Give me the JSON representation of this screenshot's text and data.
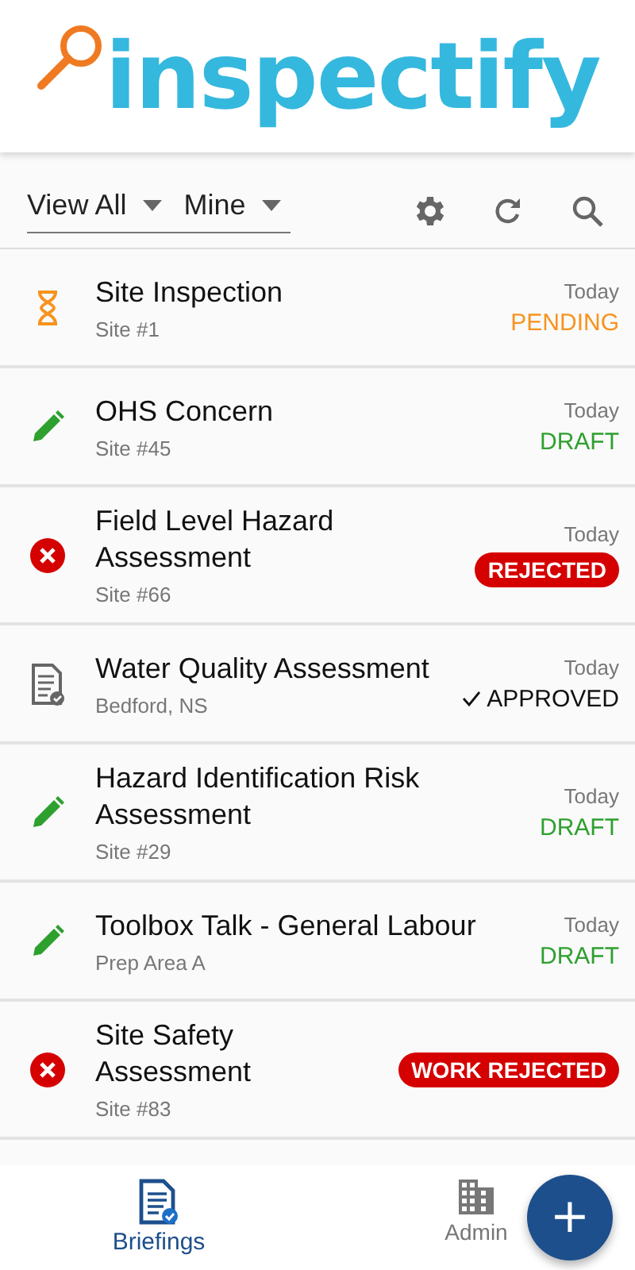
{
  "header": {
    "logo": "inspectify"
  },
  "filters": [
    {
      "label": "View All"
    },
    {
      "label": "Mine"
    }
  ],
  "items": [
    {
      "kind": "pending",
      "title": "Site Inspection",
      "subtitle": "Site #1",
      "date": "Today",
      "status": "PENDING"
    },
    {
      "kind": "draft",
      "title": "OHS Concern",
      "subtitle": "Site #45",
      "date": "Today",
      "status": "DRAFT"
    },
    {
      "kind": "rejected",
      "title": "Field Level Hazard Assessment",
      "subtitle": "Site #66",
      "date": "Today",
      "status": "REJECTED"
    },
    {
      "kind": "approved",
      "title": "Water Quality Assessment",
      "subtitle": "Bedford, NS",
      "date": "Today",
      "status": "APPROVED"
    },
    {
      "kind": "draft",
      "title": "Hazard Identification Risk Assessment",
      "subtitle": "Site #29",
      "date": "Today",
      "status": "DRAFT"
    },
    {
      "kind": "draft",
      "title": "Toolbox Talk - General Labour",
      "subtitle": "Prep Area A",
      "date": "Today",
      "status": "DRAFT"
    },
    {
      "kind": "rejected",
      "title": "Site Safety Assessment",
      "subtitle": "Site #83",
      "status": "WORK REJECTED"
    }
  ],
  "fab": {
    "label": "+"
  },
  "nav": [
    {
      "label": "Briefings",
      "selected": true
    },
    {
      "label": "Admin",
      "selected": false
    }
  ]
}
